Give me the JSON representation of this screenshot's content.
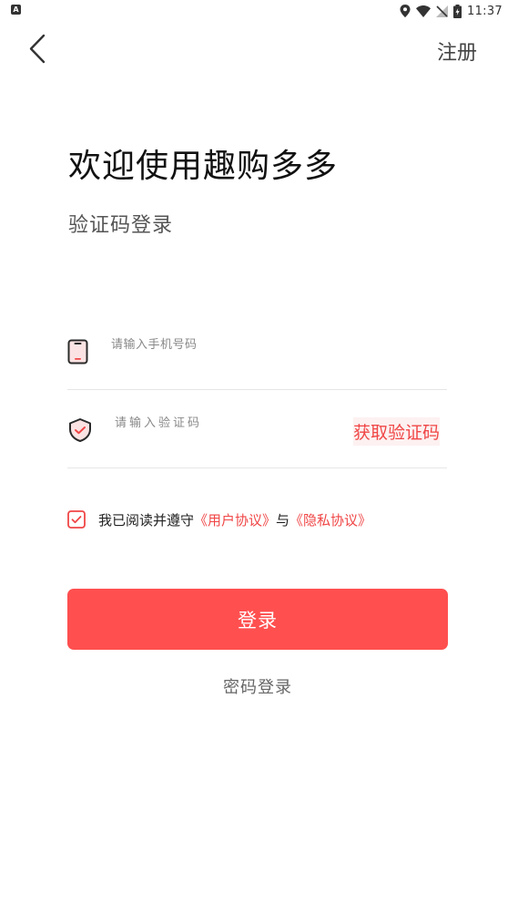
{
  "status_bar": {
    "time": "11:37",
    "left_badge": "A",
    "icons": [
      "location-icon",
      "wifi-icon",
      "no-signal-icon",
      "battery-charging-icon"
    ]
  },
  "header": {
    "back_icon": "chevron-left-icon",
    "register_label": "注册"
  },
  "title": {
    "welcome": "欢迎使用趣购多多",
    "mode": "验证码登录"
  },
  "form": {
    "phone": {
      "icon": "phone-icon",
      "placeholder": "请输入手机号码",
      "value": ""
    },
    "code": {
      "icon": "shield-icon",
      "placeholder": "请输入验证码",
      "value": "",
      "get_code_label": "获取验证码"
    }
  },
  "agreement": {
    "checked": true,
    "prefix": "我已阅读并遵守",
    "user_agreement": "《用户协议》",
    "conjunction": "与",
    "privacy_agreement": "《隐私协议》"
  },
  "actions": {
    "login_label": "登录",
    "password_login_label": "密码登录"
  },
  "colors": {
    "accent": "#ff4f4f",
    "link": "#f04646"
  }
}
